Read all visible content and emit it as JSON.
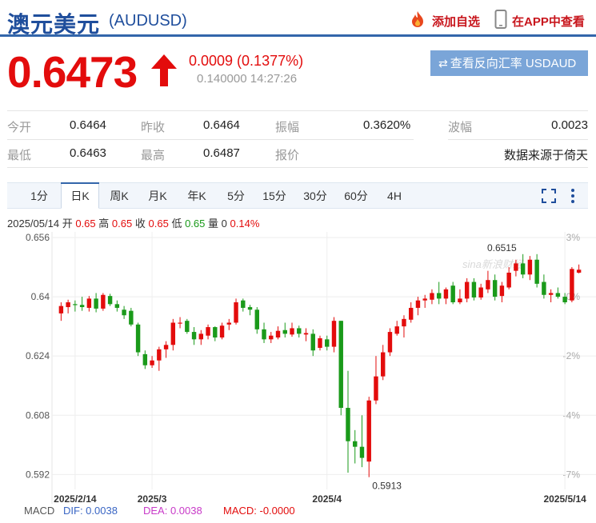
{
  "header": {
    "title": "澳元美元",
    "code": "(AUDUSD)",
    "watchlist_label": "添加自选",
    "app_label": "在APP中查看"
  },
  "quote": {
    "price": "0.6473",
    "change": "0.0009 (0.1377%)",
    "time": "0.140000 14:27:26",
    "reverse_button": "查看反向汇率 USDAUD"
  },
  "stats": [
    {
      "label": "今开",
      "value": "0.6464"
    },
    {
      "label": "昨收",
      "value": "0.6464"
    },
    {
      "label": "振幅",
      "value": "0.3620%"
    },
    {
      "label": "波幅",
      "value": "0.0023"
    },
    {
      "label": "最低",
      "value": "0.6463"
    },
    {
      "label": "最高",
      "value": "0.6487"
    },
    {
      "label": "报价",
      "value": ""
    },
    {
      "label": "",
      "value": "数据来源于倚天"
    }
  ],
  "tabs": [
    "1分",
    "日K",
    "周K",
    "月K",
    "年K",
    "5分",
    "15分",
    "30分",
    "60分",
    "4H"
  ],
  "active_tab": "日K",
  "tools": {
    "fullscreen_icon": "fullscreen-icon",
    "more_icon": "more-vertical-icon"
  },
  "info": {
    "date": "2025/05/14",
    "open_label": "开",
    "open": "0.65",
    "high_label": "高",
    "high": "0.65",
    "close_label": "收",
    "close": "0.65",
    "low_label": "低",
    "low": "0.65",
    "vol_label": "量",
    "vol": "0",
    "pct": "0.14%"
  },
  "chart_data": {
    "type": "candlestick",
    "watermark": "sina新浪财经",
    "y_ticks": [
      0.656,
      0.64,
      0.624,
      0.608,
      0.592
    ],
    "y_tick_labels": [
      "0.656",
      "0.64",
      "0.624",
      "0.608",
      "0.592"
    ],
    "pct_ticks": [
      "3%",
      "0%",
      "-2%",
      "-4%",
      "-7%"
    ],
    "ylim": [
      0.5895,
      0.6575
    ],
    "x_labels": [
      {
        "index": 2,
        "label": "2025/2/14"
      },
      {
        "index": 13,
        "label": "2025/3"
      },
      {
        "index": 38,
        "label": "2025/4"
      },
      {
        "index": 72,
        "label": "2025/5/14"
      }
    ],
    "annotations": [
      {
        "index": 66,
        "label": "0.6515",
        "value": 0.6515
      },
      {
        "index": 44,
        "label": "0.5913",
        "value": 0.5913
      }
    ],
    "candles": [
      {
        "o": 0.6355,
        "h": 0.6385,
        "l": 0.6335,
        "c": 0.6375
      },
      {
        "o": 0.6372,
        "h": 0.6392,
        "l": 0.6355,
        "c": 0.6385
      },
      {
        "o": 0.638,
        "h": 0.639,
        "l": 0.636,
        "c": 0.6378
      },
      {
        "o": 0.6378,
        "h": 0.64,
        "l": 0.6362,
        "c": 0.6372
      },
      {
        "o": 0.637,
        "h": 0.6402,
        "l": 0.636,
        "c": 0.6395
      },
      {
        "o": 0.6395,
        "h": 0.641,
        "l": 0.6358,
        "c": 0.6368
      },
      {
        "o": 0.6368,
        "h": 0.641,
        "l": 0.6362,
        "c": 0.6405
      },
      {
        "o": 0.6402,
        "h": 0.6408,
        "l": 0.6375,
        "c": 0.638
      },
      {
        "o": 0.638,
        "h": 0.639,
        "l": 0.636,
        "c": 0.637
      },
      {
        "o": 0.6365,
        "h": 0.6375,
        "l": 0.634,
        "c": 0.635
      },
      {
        "o": 0.6362,
        "h": 0.637,
        "l": 0.632,
        "c": 0.6325
      },
      {
        "o": 0.6325,
        "h": 0.633,
        "l": 0.624,
        "c": 0.625
      },
      {
        "o": 0.6245,
        "h": 0.6255,
        "l": 0.6205,
        "c": 0.6215
      },
      {
        "o": 0.6215,
        "h": 0.624,
        "l": 0.6208,
        "c": 0.6228
      },
      {
        "o": 0.6228,
        "h": 0.6265,
        "l": 0.62,
        "c": 0.6258
      },
      {
        "o": 0.6258,
        "h": 0.628,
        "l": 0.6235,
        "c": 0.627
      },
      {
        "o": 0.627,
        "h": 0.634,
        "l": 0.6255,
        "c": 0.633
      },
      {
        "o": 0.633,
        "h": 0.6345,
        "l": 0.6315,
        "c": 0.633
      },
      {
        "o": 0.6335,
        "h": 0.634,
        "l": 0.63,
        "c": 0.6305
      },
      {
        "o": 0.6305,
        "h": 0.6318,
        "l": 0.627,
        "c": 0.6285
      },
      {
        "o": 0.6285,
        "h": 0.631,
        "l": 0.627,
        "c": 0.63
      },
      {
        "o": 0.6295,
        "h": 0.6325,
        "l": 0.6285,
        "c": 0.6318
      },
      {
        "o": 0.6318,
        "h": 0.632,
        "l": 0.628,
        "c": 0.629
      },
      {
        "o": 0.629,
        "h": 0.633,
        "l": 0.6285,
        "c": 0.6322
      },
      {
        "o": 0.6325,
        "h": 0.634,
        "l": 0.631,
        "c": 0.633
      },
      {
        "o": 0.633,
        "h": 0.6395,
        "l": 0.6325,
        "c": 0.6385
      },
      {
        "o": 0.639,
        "h": 0.6395,
        "l": 0.636,
        "c": 0.637
      },
      {
        "o": 0.6372,
        "h": 0.6378,
        "l": 0.635,
        "c": 0.6365
      },
      {
        "o": 0.6365,
        "h": 0.6372,
        "l": 0.63,
        "c": 0.6312
      },
      {
        "o": 0.6312,
        "h": 0.633,
        "l": 0.6275,
        "c": 0.6285
      },
      {
        "o": 0.6285,
        "h": 0.6305,
        "l": 0.6275,
        "c": 0.6295
      },
      {
        "o": 0.629,
        "h": 0.632,
        "l": 0.6285,
        "c": 0.6308
      },
      {
        "o": 0.631,
        "h": 0.633,
        "l": 0.629,
        "c": 0.63
      },
      {
        "o": 0.6298,
        "h": 0.633,
        "l": 0.6292,
        "c": 0.6315
      },
      {
        "o": 0.6315,
        "h": 0.6322,
        "l": 0.629,
        "c": 0.63
      },
      {
        "o": 0.6298,
        "h": 0.6315,
        "l": 0.628,
        "c": 0.6302
      },
      {
        "o": 0.63,
        "h": 0.6312,
        "l": 0.624,
        "c": 0.6255
      },
      {
        "o": 0.6262,
        "h": 0.6295,
        "l": 0.6255,
        "c": 0.6288
      },
      {
        "o": 0.6285,
        "h": 0.6295,
        "l": 0.6255,
        "c": 0.6265
      },
      {
        "o": 0.6265,
        "h": 0.6345,
        "l": 0.625,
        "c": 0.6335
      },
      {
        "o": 0.6335,
        "h": 0.6335,
        "l": 0.608,
        "c": 0.61
      },
      {
        "o": 0.61,
        "h": 0.62,
        "l": 0.5925,
        "c": 0.601
      },
      {
        "o": 0.601,
        "h": 0.604,
        "l": 0.595,
        "c": 0.5995
      },
      {
        "o": 0.5995,
        "h": 0.608,
        "l": 0.594,
        "c": 0.5965
      },
      {
        "o": 0.5955,
        "h": 0.613,
        "l": 0.5913,
        "c": 0.612
      },
      {
        "o": 0.612,
        "h": 0.624,
        "l": 0.611,
        "c": 0.6185
      },
      {
        "o": 0.6185,
        "h": 0.627,
        "l": 0.6175,
        "c": 0.625
      },
      {
        "o": 0.625,
        "h": 0.6315,
        "l": 0.624,
        "c": 0.6305
      },
      {
        "o": 0.63,
        "h": 0.6335,
        "l": 0.6295,
        "c": 0.632
      },
      {
        "o": 0.632,
        "h": 0.635,
        "l": 0.629,
        "c": 0.634
      },
      {
        "o": 0.6338,
        "h": 0.6385,
        "l": 0.633,
        "c": 0.637
      },
      {
        "o": 0.637,
        "h": 0.64,
        "l": 0.635,
        "c": 0.639
      },
      {
        "o": 0.639,
        "h": 0.6405,
        "l": 0.637,
        "c": 0.6395
      },
      {
        "o": 0.6392,
        "h": 0.642,
        "l": 0.638,
        "c": 0.641
      },
      {
        "o": 0.641,
        "h": 0.644,
        "l": 0.638,
        "c": 0.6395
      },
      {
        "o": 0.6395,
        "h": 0.6425,
        "l": 0.638,
        "c": 0.642
      },
      {
        "o": 0.643,
        "h": 0.644,
        "l": 0.638,
        "c": 0.6385
      },
      {
        "o": 0.6385,
        "h": 0.642,
        "l": 0.638,
        "c": 0.6395
      },
      {
        "o": 0.6395,
        "h": 0.645,
        "l": 0.6385,
        "c": 0.644
      },
      {
        "o": 0.644,
        "h": 0.645,
        "l": 0.639,
        "c": 0.6398
      },
      {
        "o": 0.6398,
        "h": 0.6435,
        "l": 0.6392,
        "c": 0.6425
      },
      {
        "o": 0.642,
        "h": 0.647,
        "l": 0.641,
        "c": 0.6445
      },
      {
        "o": 0.6445,
        "h": 0.646,
        "l": 0.639,
        "c": 0.64
      },
      {
        "o": 0.6402,
        "h": 0.644,
        "l": 0.6385,
        "c": 0.643
      },
      {
        "o": 0.6425,
        "h": 0.648,
        "l": 0.642,
        "c": 0.6465
      },
      {
        "o": 0.647,
        "h": 0.65,
        "l": 0.6455,
        "c": 0.649
      },
      {
        "o": 0.649,
        "h": 0.6515,
        "l": 0.645,
        "c": 0.646
      },
      {
        "o": 0.646,
        "h": 0.651,
        "l": 0.6445,
        "c": 0.65
      },
      {
        "o": 0.65,
        "h": 0.6515,
        "l": 0.6425,
        "c": 0.6435
      },
      {
        "o": 0.644,
        "h": 0.646,
        "l": 0.6395,
        "c": 0.6405
      },
      {
        "o": 0.6405,
        "h": 0.642,
        "l": 0.6385,
        "c": 0.641
      },
      {
        "o": 0.641,
        "h": 0.6425,
        "l": 0.6395,
        "c": 0.64
      },
      {
        "o": 0.64,
        "h": 0.641,
        "l": 0.638,
        "c": 0.6385
      },
      {
        "o": 0.639,
        "h": 0.648,
        "l": 0.6385,
        "c": 0.6475
      },
      {
        "o": 0.6465,
        "h": 0.6487,
        "l": 0.6463,
        "c": 0.6473
      }
    ]
  },
  "macd": {
    "label": "MACD",
    "dif": "DIF: 0.0038",
    "dea": "DEA: 0.0038",
    "macd": "MACD: -0.0000"
  },
  "colors": {
    "up": "#e30c0c",
    "down": "#1a9a1a",
    "brand": "#1f4e9c"
  }
}
